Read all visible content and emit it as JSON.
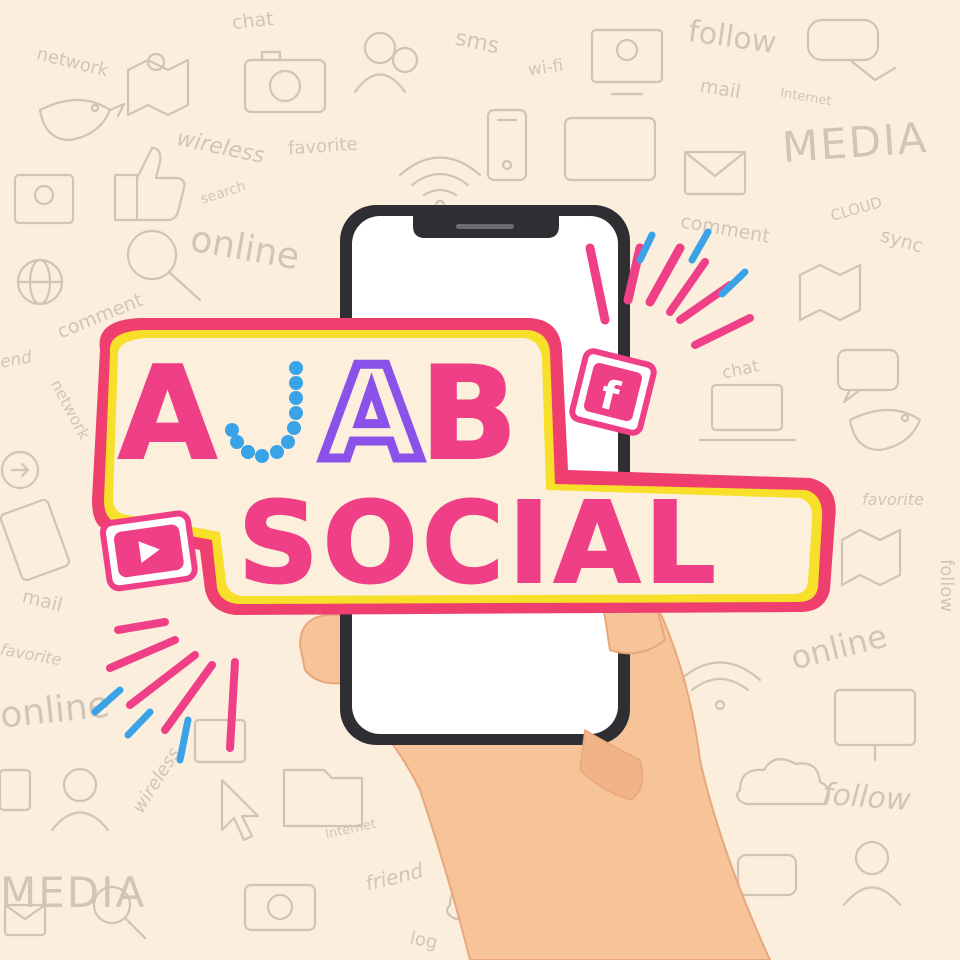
{
  "logo": {
    "line1_part1": "A",
    "line1_part2": "J",
    "line1_part3": "A",
    "line1_part4": "B",
    "line2": "SOCIAL"
  },
  "icons": {
    "facebook_glyph": "f",
    "youtube": "youtube-play-icon"
  },
  "background_words": [
    "chat",
    "sms",
    "follow",
    "network",
    "wi-fi",
    "mail",
    "Internet",
    "wireless",
    "favorite",
    "MEDIA",
    "search",
    "online",
    "comment",
    "CLOUD",
    "sync",
    "sync",
    "comment",
    "network",
    "end",
    "chat",
    "favorite",
    "follow",
    "online",
    "wireless",
    "Internet",
    "friend",
    "MEDIA",
    "online",
    "favorite",
    "mail",
    "follow",
    "log"
  ],
  "colors": {
    "background": "#fbeedc",
    "pink": "#ef3f86",
    "purple": "#8a52e8",
    "blue": "#3aa3e8",
    "yellow": "#f8df2a",
    "cream": "#fcefdc",
    "outline": "#ee3f6f",
    "skin": "#f7c49a",
    "phone": "#2f2f33"
  }
}
